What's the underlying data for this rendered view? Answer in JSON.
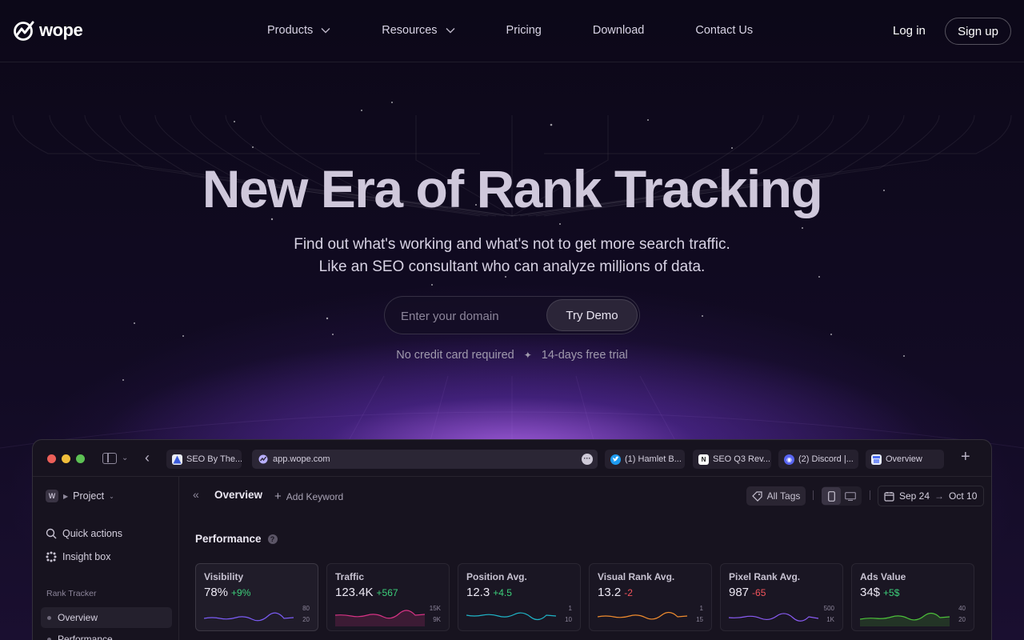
{
  "brand": {
    "name": "wope"
  },
  "nav": {
    "menu": [
      {
        "label": "Products",
        "has_dropdown": true
      },
      {
        "label": "Resources",
        "has_dropdown": true
      },
      {
        "label": "Pricing",
        "has_dropdown": false
      },
      {
        "label": "Download",
        "has_dropdown": false
      },
      {
        "label": "Contact Us",
        "has_dropdown": false
      }
    ],
    "login_label": "Log in",
    "signup_label": "Sign up"
  },
  "hero": {
    "title": "New Era of Rank Tracking",
    "subtitle_line1": "Find out what's working and what's not to get more search traffic.",
    "subtitle_line2": "Like an SEO consultant who can analyze millions of data.",
    "domain_placeholder": "Enter your domain",
    "try_demo_label": "Try Demo",
    "hint_left": "No credit card required",
    "hint_right": "14-days free trial"
  },
  "app": {
    "tabs": [
      {
        "label": "SEO By The...",
        "icon": "pyramid-icon",
        "color": "#3b5bdb"
      },
      {
        "label": "(1) Hamlet B...",
        "icon": "twitter-icon",
        "color": "#1d9bf0"
      },
      {
        "label": "SEO Q3 Rev...",
        "icon": "notion-icon",
        "color": "#ffffff"
      },
      {
        "label": "(2) Discord |...",
        "icon": "discord-icon",
        "color": "#5865f2"
      },
      {
        "label": "Overview",
        "icon": "store-icon",
        "color": "#4c6ef5"
      }
    ],
    "url": "app.wope.com",
    "sidebar": {
      "project_label": "Project",
      "project_initial": "W",
      "quick_actions": "Quick actions",
      "insight_box": "Insight box",
      "section_label": "Rank Tracker",
      "items": [
        "Overview",
        "Performance"
      ]
    },
    "header": {
      "title": "Overview",
      "add_keyword": "Add Keyword",
      "all_tags": "All Tags",
      "date_from": "Sep 24",
      "date_to": "Oct 10"
    },
    "performance_title": "Performance",
    "help_glyph": "?",
    "more_glyph": "···",
    "cards": [
      {
        "label": "Visibility",
        "value": "78%",
        "delta": "+9%",
        "trend": "up",
        "tick_top": "80",
        "tick_bottom": "20",
        "color": "#7b5cf5"
      },
      {
        "label": "Traffic",
        "value": "123.4K",
        "delta": "+567",
        "trend": "up",
        "tick_top": "15K",
        "tick_bottom": "9K",
        "color": "#d63384"
      },
      {
        "label": "Position Avg.",
        "value": "12.3",
        "delta": "+4.5",
        "trend": "up",
        "tick_top": "1",
        "tick_bottom": "10",
        "color": "#1fb6c9"
      },
      {
        "label": "Visual Rank Avg.",
        "value": "13.2",
        "delta": "-2",
        "trend": "down",
        "tick_top": "1",
        "tick_bottom": "15",
        "color": "#f08c2e"
      },
      {
        "label": "Pixel Rank Avg.",
        "value": "987",
        "delta": "-65",
        "trend": "down",
        "tick_top": "500",
        "tick_bottom": "1K",
        "color": "#8b5cf6"
      },
      {
        "label": "Ads Value",
        "value": "34$",
        "delta": "+5$",
        "trend": "up",
        "tick_top": "40",
        "tick_bottom": "20",
        "color": "#4cbf3a"
      }
    ]
  }
}
